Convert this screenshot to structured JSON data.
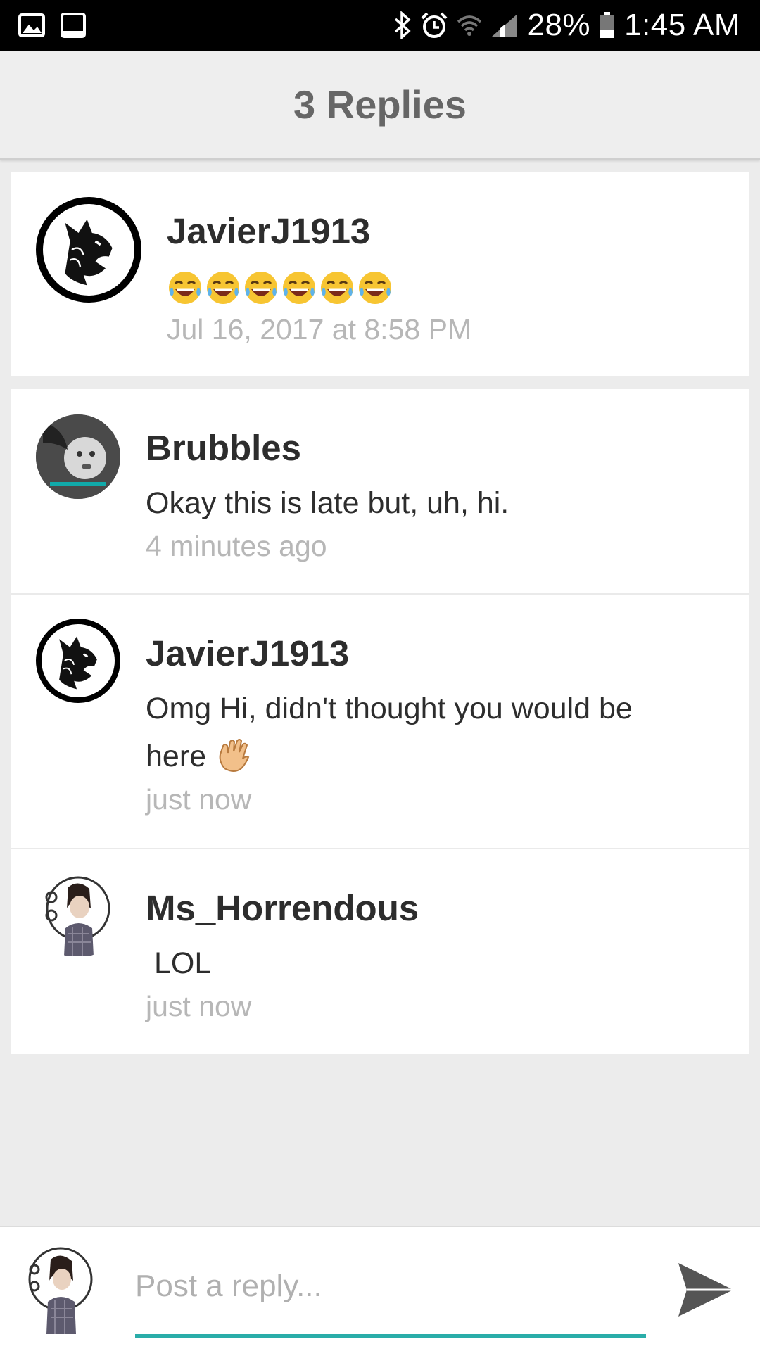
{
  "status_bar": {
    "battery_percent": "28%",
    "time": "1:45 AM",
    "icons": [
      "gallery-icon",
      "tablet-icon",
      "bluetooth-icon",
      "alarm-icon",
      "wifi-icon",
      "signal-icon",
      "battery-icon"
    ]
  },
  "header": {
    "title": "3 Replies"
  },
  "original_post": {
    "username": "JavierJ1913",
    "emoji_count": 6,
    "emoji_name": "face-with-tears-of-joy",
    "timestamp": "Jul 16, 2017 at 8:58 PM",
    "avatar": "wolf-logo-avatar"
  },
  "replies": [
    {
      "username": "Brubbles",
      "text": "Okay this is late but, uh, hi.",
      "timestamp": "4 minutes ago",
      "avatar": "photo-avatar"
    },
    {
      "username": "JavierJ1913",
      "text_line1": "Omg Hi, didn't thought you would be",
      "text_line2": "here",
      "emoji_name": "waving-hand",
      "timestamp": "just now",
      "avatar": "wolf-logo-avatar"
    },
    {
      "username": "Ms_Horrendous",
      "text": "LOL",
      "timestamp": "just now",
      "avatar": "cartoon-girl-avatar"
    }
  ],
  "composer": {
    "placeholder": "Post a reply...",
    "value": "",
    "accent_color": "#2aada9"
  }
}
